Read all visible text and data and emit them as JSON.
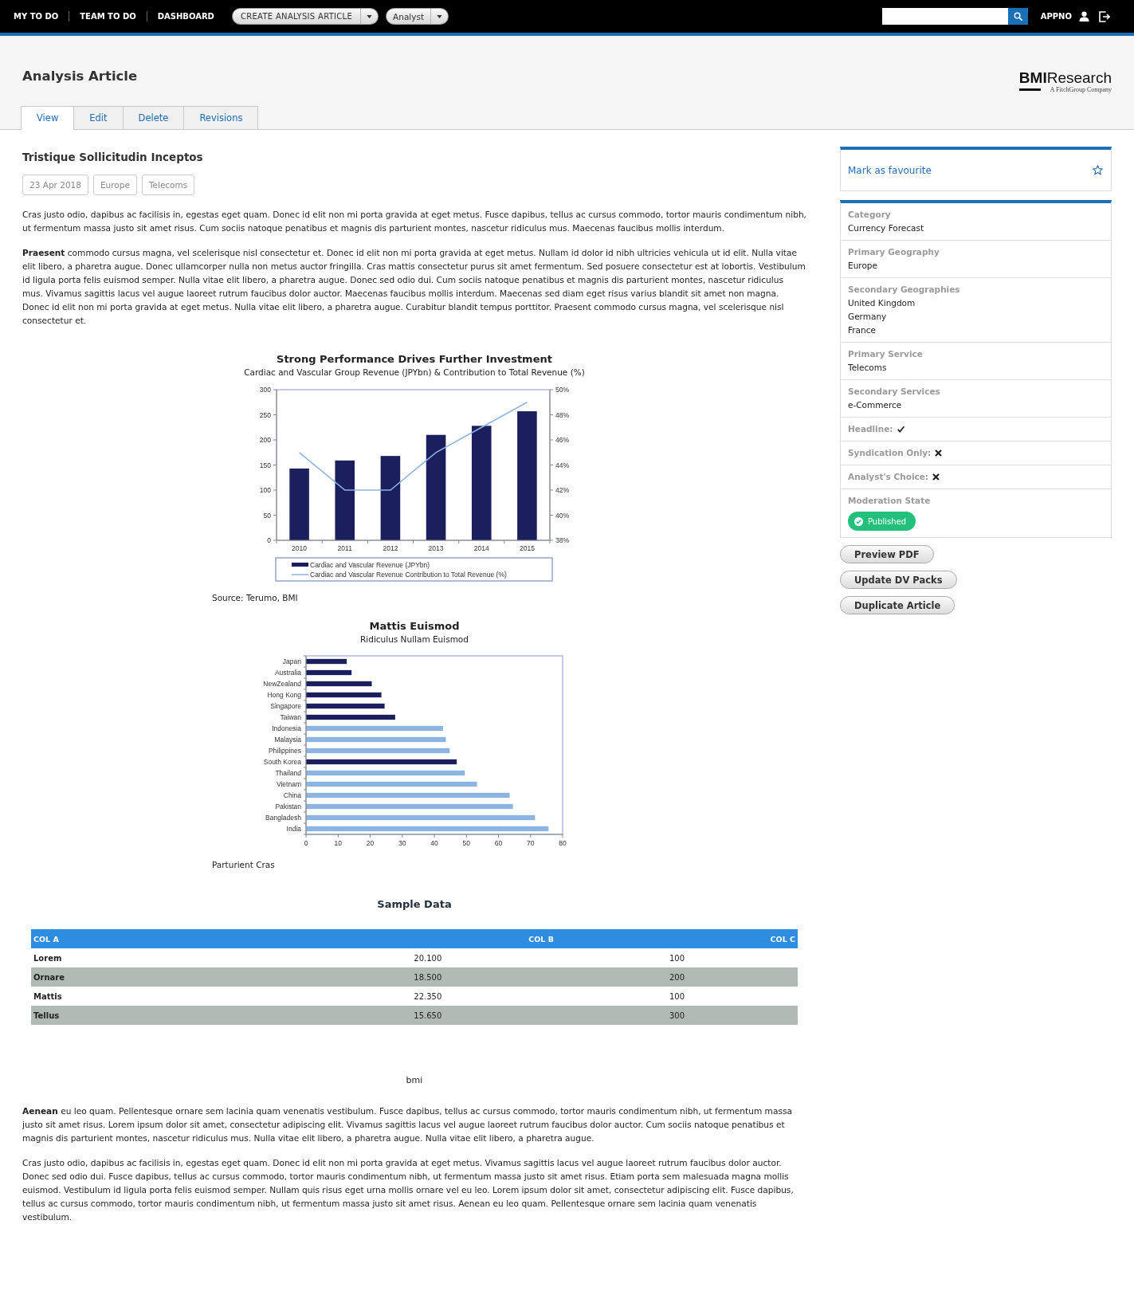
{
  "top_bar": {
    "nav_links": [
      "MY TO DO",
      "TEAM TO DO",
      "DASHBOARD"
    ],
    "create_button": {
      "label": "CREATE ANALYSIS ARTICLE"
    },
    "role_button": {
      "label": "Analyst"
    },
    "user": "APPNO"
  },
  "header": {
    "title": "Analysis Article",
    "logo": {
      "text": "**BMI**Research",
      "tagline": "A FitchGroup Company"
    }
  },
  "tabs": [
    {
      "label": "View",
      "selected": true
    },
    {
      "label": "Edit",
      "selected": false
    },
    {
      "label": "Delete",
      "selected": false
    },
    {
      "label": "Revisions",
      "selected": false
    }
  ],
  "article": {
    "title": "Tristique Sollicitudin Inceptos",
    "tags": [
      "23 Apr 2018",
      "Europe",
      "Telecoms"
    ],
    "blocks": [
      {
        "kind": "paragraph",
        "text": "Cras justo odio, dapibus ac facilisis in, egestas eget quam. Donec id elit non mi porta gravida at eget metus. Fusce dapibus, tellus ac cursus commodo, tortor mauris condimentum nibh, ut fermentum massa justo sit amet risus. Cum sociis natoque penatibus et magnis dis parturient montes, nascetur ridiculus mus. Maecenas faucibus mollis interdum."
      },
      {
        "kind": "paragraph",
        "text": "**Praesent** commodo cursus magna, vel scelerisque nisl consectetur et. Donec id elit non mi porta gravida at eget metus. Nullam id dolor id nibh ultricies vehicula ut id elit. Nulla vitae elit libero, a pharetra augue. Donec ullamcorper nulla non metus auctor fringilla. Cras mattis consectetur purus sit amet fermentum. Sed posuere consectetur est at lobortis. Vestibulum id ligula porta felis euismod semper. Nulla vitae elit libero, a pharetra augue. Donec sed odio dui. Cum sociis natoque penatibus et magnis dis parturient montes, nascetur ridiculus mus. Vivamus sagittis lacus vel augue laoreet rutrum faucibus dolor auctor. Maecenas faucibus mollis interdum. Maecenas sed diam eget risus varius blandit sit amet non magna. Donec id elit non mi porta gravida at eget metus. Nulla vitae elit libero, a pharetra augue. Curabitur blandit tempus porttitor. Praesent commodo cursus magna, vel scelerisque nisl consectetur et."
      },
      {
        "kind": "figure",
        "caption": "Source: Terumo, BMI",
        "chart_data": {
          "type": "bar",
          "title": "Strong Performance Drives Further Investment",
          "subtitle": "Cardiac and Vascular Group Revenue (JPYbn) & Contribution to Total Revenue (%)",
          "categories": [
            "2010",
            "2011",
            "2012",
            "2013",
            "2014",
            "2015"
          ],
          "series": [
            {
              "name": "Cardiac and Vascular Revenue (JPYbn)",
              "type": "bar",
              "color": "#1b1f5e",
              "values": [
                143,
                159,
                168,
                210,
                228,
                257
              ]
            },
            {
              "name": "Cardiac and Vascular Revenue Contribution to Total Revenue (%)",
              "type": "line",
              "axis": "y2",
              "color": "#8db3e2",
              "values": [
                45,
                42,
                42,
                45,
                47,
                49
              ]
            }
          ],
          "legend": "bottom",
          "ylim": [
            0,
            300
          ],
          "yticks": [
            {
              "value": 0,
              "label": "0"
            },
            {
              "value": 50,
              "label": "50"
            },
            {
              "value": 100,
              "label": "100"
            },
            {
              "value": 150,
              "label": "150"
            },
            {
              "value": 200,
              "label": "200"
            },
            {
              "value": 250,
              "label": "250"
            },
            {
              "value": 300,
              "label": "300"
            }
          ],
          "y2lim": [
            38,
            50
          ],
          "y2ticks": [
            {
              "value": 38,
              "label": "38%"
            },
            {
              "value": 40,
              "label": "40%"
            },
            {
              "value": 42,
              "label": "42%"
            },
            {
              "value": 44,
              "label": "44%"
            },
            {
              "value": 46,
              "label": "46%"
            },
            {
              "value": 48,
              "label": "48%"
            },
            {
              "value": 50,
              "label": "50%"
            }
          ]
        }
      },
      {
        "kind": "figure",
        "caption": "Parturient Cras",
        "chart_data": {
          "type": "bar",
          "orientation": "horizontal",
          "title": "Mattis Euismod",
          "subtitle": "Ridiculus Nullam Euismod",
          "categories": [
            "Japan",
            "Australia",
            "NewZealand",
            "Hong Kong",
            "Singapore",
            "Taiwan",
            "Indonesia",
            "Malaysia",
            "Philippines",
            "South Korea",
            "Thailand",
            "Vietnam",
            "China",
            "Pakistan",
            "Bangladesh",
            "India"
          ],
          "series": [
            {
              "color": "#1b1f5e",
              "values": [
                12.7,
                14.2,
                20.5,
                23.5,
                24.5,
                27.8,
                null,
                null,
                null,
                47.0,
                null,
                null,
                null,
                null,
                null,
                null
              ]
            },
            {
              "color": "#8db3e2",
              "values": [
                null,
                null,
                null,
                null,
                null,
                null,
                42.7,
                43.6,
                44.8,
                null,
                49.5,
                53.3,
                63.5,
                64.5,
                71.4,
                75.6
              ]
            }
          ],
          "xlim": [
            0,
            80
          ],
          "xticks": [
            0,
            10,
            20,
            30,
            40,
            50,
            60,
            70,
            80
          ]
        }
      },
      {
        "kind": "table",
        "title": "Sample Data",
        "columns": [
          "COL A",
          "COL B",
          "COL C"
        ],
        "rows": [
          [
            "Lorem",
            "20.100",
            "100"
          ],
          [
            "Ornare",
            "18.500",
            "200"
          ],
          [
            "Mattis",
            "22.350",
            "100"
          ],
          [
            "Tellus",
            "15.650",
            "300"
          ]
        ],
        "caption": "bmi"
      },
      {
        "kind": "paragraph",
        "text": "**Aenean** eu leo quam. Pellentesque ornare sem lacinia quam venenatis vestibulum. Fusce dapibus, tellus ac cursus commodo, tortor mauris condimentum nibh, ut fermentum massa justo sit amet risus. Lorem ipsum dolor sit amet, consectetur adipiscing elit. Vivamus sagittis lacus vel augue laoreet rutrum faucibus dolor auctor. Cum sociis natoque penatibus et magnis dis parturient montes, nascetur ridiculus mus. Nulla vitae elit libero, a pharetra augue. Nulla vitae elit libero, a pharetra augue."
      },
      {
        "kind": "paragraph",
        "text": "Cras justo odio, dapibus ac facilisis in, egestas eget quam. Donec id elit non mi porta gravida at eget metus. Vivamus sagittis lacus vel augue laoreet rutrum faucibus dolor auctor. Donec sed odio dui. Fusce dapibus, tellus ac cursus commodo, tortor mauris condimentum nibh, ut fermentum massa justo sit amet risus. Etiam porta sem malesuada magna mollis euismod. Vestibulum id ligula porta felis euismod semper. Nullam quis risus eget urna mollis ornare vel eu leo. Lorem ipsum dolor sit amet, consectetur adipiscing elit. Fusce dapibus, tellus ac cursus commodo, tortor mauris condimentum nibh, ut fermentum massa justo sit amet risus. Aenean eu leo quam. Pellentesque ornare sem lacinia quam venenatis vestibulum."
      }
    ]
  },
  "sidebar": {
    "favourite": {
      "label": "Mark as favourite",
      "favourited": false
    },
    "details": [
      {
        "kind": "field",
        "label": "Category",
        "values": [
          "Currency Forecast"
        ]
      },
      {
        "kind": "field",
        "label": "Primary Geography",
        "values": [
          "Europe"
        ]
      },
      {
        "kind": "field",
        "label": "Secondary Geographies",
        "values": [
          "United Kingdom",
          "Germany",
          "France"
        ]
      },
      {
        "kind": "field",
        "label": "Primary Service",
        "values": [
          "Telecoms"
        ]
      },
      {
        "kind": "field",
        "label": "Secondary Services",
        "values": [
          "e-Commerce"
        ]
      },
      {
        "kind": "flag",
        "label": "Headline:",
        "checked": true
      },
      {
        "kind": "flag",
        "label": "Syndication Only:",
        "checked": false
      },
      {
        "kind": "flag",
        "label": "Analyst's Choice:",
        "checked": false
      },
      {
        "kind": "status",
        "label": "Moderation State",
        "status": "Published"
      }
    ],
    "buttons": [
      "Preview PDF",
      "Update DV Packs",
      "Duplicate Article"
    ]
  }
}
